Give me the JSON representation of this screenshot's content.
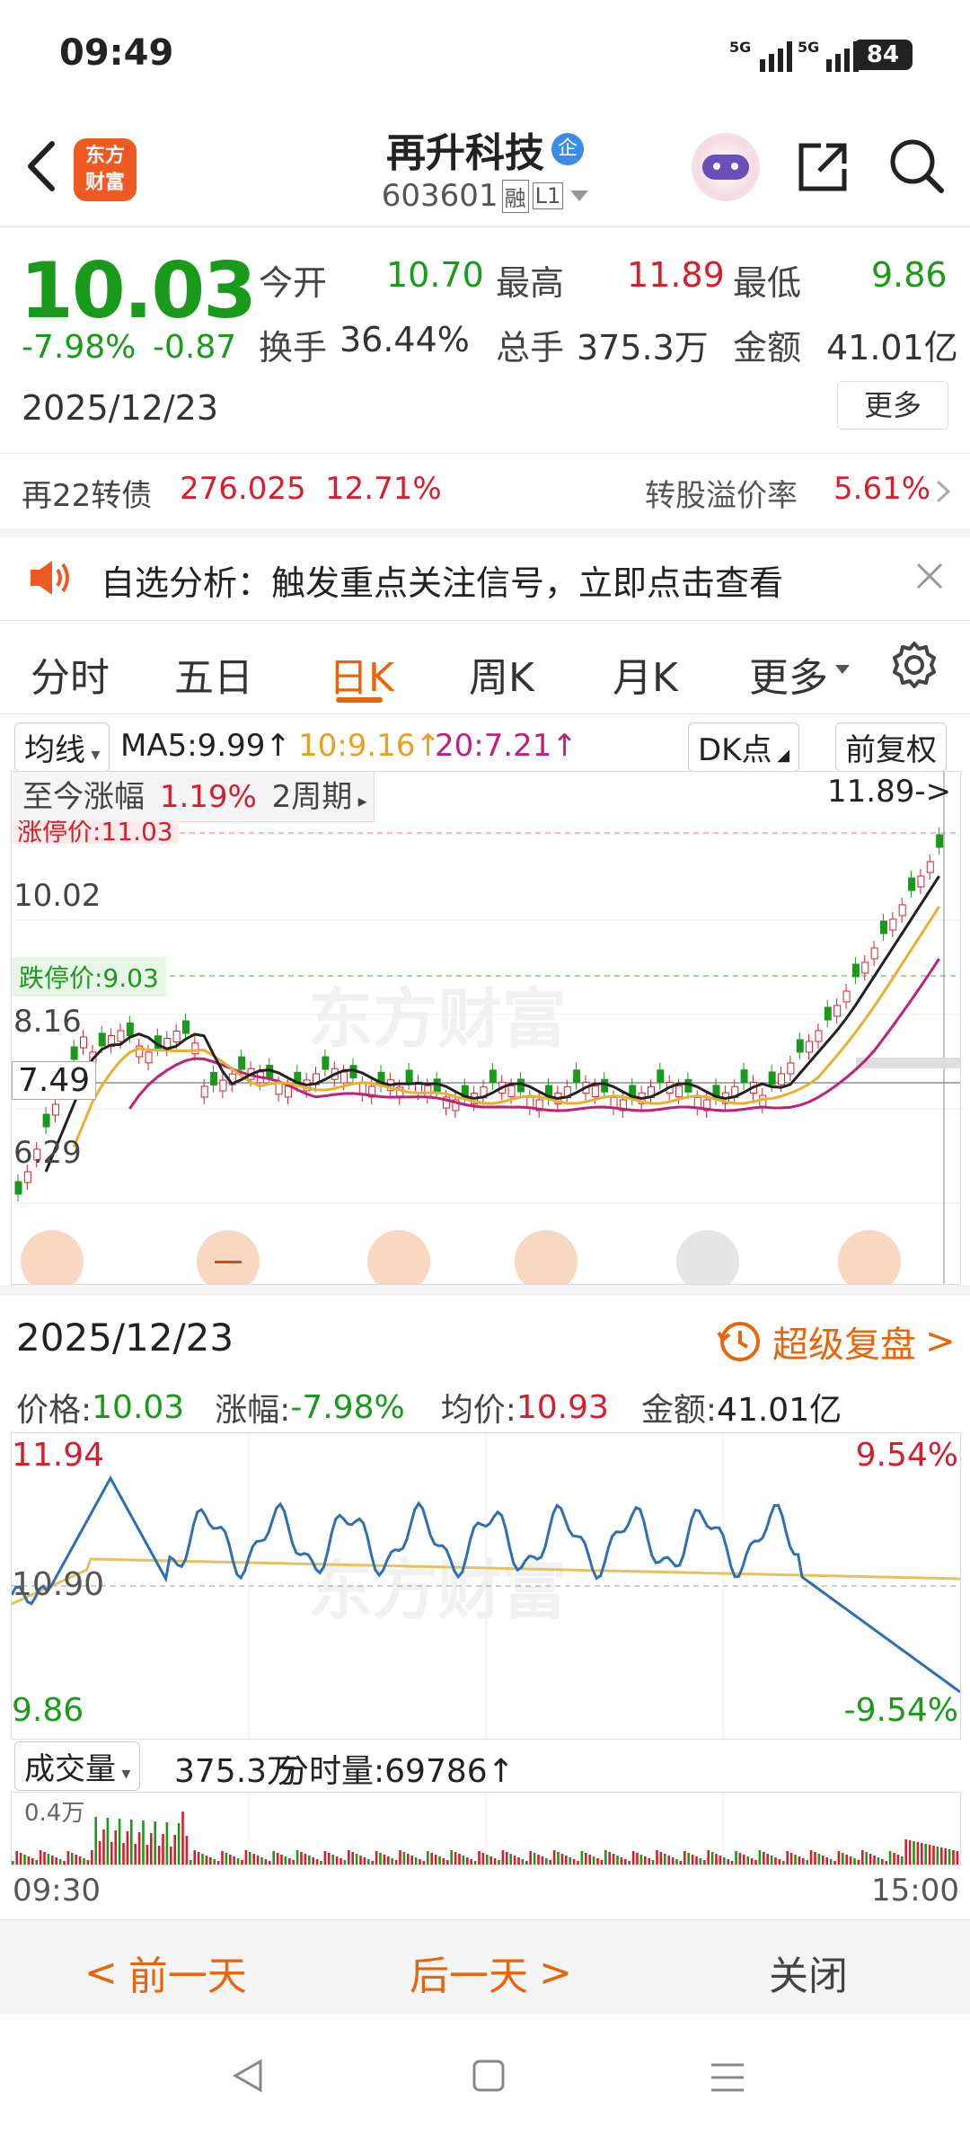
{
  "status_bar": {
    "time": "09:49",
    "net1": "5G",
    "net2": "5G",
    "battery": "84"
  },
  "header": {
    "stock_name": "再升科技",
    "badge": "企",
    "code": "603601",
    "tag_rong": "融",
    "tag_level": "L1",
    "logo_line1": "东方",
    "logo_line2": "财富"
  },
  "quote": {
    "price": "10.03",
    "change_pct": "-7.98%",
    "change": "-0.87",
    "date": "2025/12/23",
    "open_label": "今开",
    "open": "10.70",
    "high_label": "最高",
    "high": "11.89",
    "low_label": "最低",
    "low": "9.86",
    "turnover_label": "换手",
    "turnover": "36.44%",
    "volume_label": "总手",
    "volume": "375.3万",
    "amount_label": "金额",
    "amount": "41.01亿",
    "more": "更多"
  },
  "bond": {
    "name": "再22转债",
    "price": "276.025",
    "pct": "12.71%",
    "premium_label": "转股溢价率",
    "premium": "5.61%"
  },
  "alert": {
    "text": "自选分析：触发重点关注信号，立即点击查看"
  },
  "tabs": [
    "分时",
    "五日",
    "日K",
    "周K",
    "月K",
    "更多"
  ],
  "active_tab": "日K",
  "kline": {
    "ma_selector": "均线",
    "ma5": "MA5:9.99↑",
    "ma10": "10:9.16↑",
    "ma20": "20:7.21↑",
    "dk_button": "DK点",
    "adjust_button": "前复权",
    "range_label": "至今涨幅",
    "range_pct": "1.19%",
    "range_period": "2周期",
    "max_label": "11.89->",
    "limit_up": "涨停价:11.03",
    "limit_down": "跌停价:9.03",
    "y_labels": [
      "10.02",
      "8.16",
      "7.49",
      "6.29"
    ],
    "watermark": "东方财富"
  },
  "intraday": {
    "date": "2025/12/23",
    "replay": "超级复盘",
    "price_label": "价格:",
    "price": "10.03",
    "chg_label": "涨幅:",
    "chg": "-7.98%",
    "avg_label": "均价:",
    "avg": "10.93",
    "amt_label": "金额:",
    "amt": "41.01亿",
    "y_top": "11.94",
    "y_mid": "10.90",
    "y_bot": "9.86",
    "pct_top": "9.54%",
    "pct_bot": "-9.54%",
    "vol_selector": "成交量",
    "vol_total": "375.3万",
    "vol_tick_label": "分时量:69786↑",
    "vol_scale": "0.4万",
    "time_start": "09:30",
    "time_end": "15:00",
    "watermark": "东方财富"
  },
  "bottom": {
    "prev": "前一天",
    "next": "后一天",
    "close": "关闭"
  },
  "colors": {
    "up": "#d81e2c",
    "down": "#1a9a1a",
    "accent": "#e8650c",
    "ma5": "#222222",
    "ma10": "#e8b030",
    "ma20": "#c0207a",
    "intraday_line": "#2c6fb5"
  }
}
